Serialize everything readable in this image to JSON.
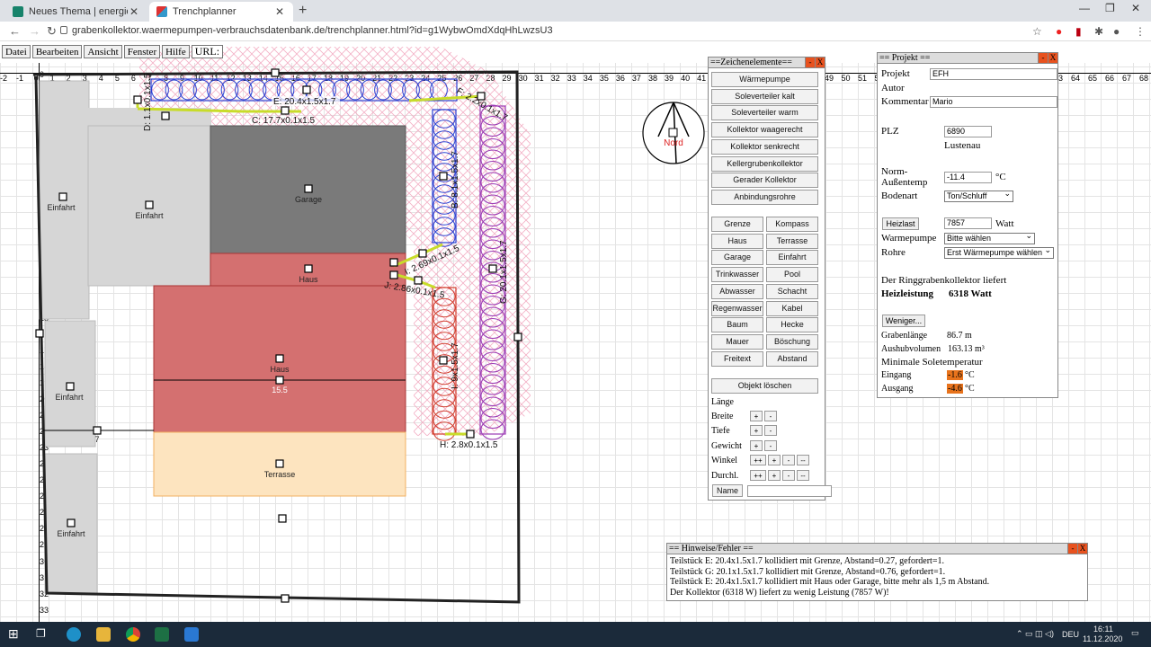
{
  "browser": {
    "tabs": [
      {
        "title": "Neues Thema | energiesparhaus.at"
      },
      {
        "title": "Trenchplanner"
      }
    ],
    "url": "grabenkollektor.waermepumpen-verbrauchsdatenbank.de/trenchplanner.html?id=g1WybwOmdXdqHhLwzsU3"
  },
  "menu": [
    "Datei",
    "Bearbeiten",
    "Ansicht",
    "Fenster",
    "Hilfe"
  ],
  "menu_url_label": "URL:",
  "scale_x": [
    "-2",
    "-1",
    "0",
    "1",
    "2",
    "3",
    "4",
    "5",
    "6",
    "7",
    "8",
    "9",
    "10",
    "11",
    "12",
    "13",
    "14",
    "15",
    "16",
    "17",
    "18",
    "19",
    "20",
    "21",
    "22",
    "23",
    "24",
    "25",
    "26",
    "27",
    "28",
    "29",
    "30",
    "31",
    "32",
    "33",
    "34",
    "35",
    "36",
    "37",
    "38",
    "39",
    "40",
    "41",
    "42"
  ],
  "scale_x_right": [
    "49",
    "50",
    "51",
    "52",
    "53"
  ],
  "scale_x_far": [
    "63",
    "64",
    "65",
    "66",
    "67",
    "68"
  ],
  "scale_y": [
    "0",
    "1",
    "2",
    "3",
    "4",
    "5",
    "6",
    "7",
    "8",
    "9",
    "10",
    "11",
    "12",
    "13",
    "14",
    "15",
    "16",
    "17",
    "18",
    "19",
    "20",
    "21",
    "22",
    "23",
    "24",
    "25",
    "26",
    "27",
    "28",
    "29",
    "30",
    "31",
    "32",
    "33"
  ],
  "plan": {
    "labels": {
      "einfahrt": "Einfahrt",
      "garage": "Garage",
      "haus": "Haus",
      "terrasse": "Terrasse",
      "nord": "Nord",
      "haus_dim": "15.5",
      "left_dim": "7"
    },
    "trench_labels": {
      "e": "E: 20.4x1.5x1.7",
      "c": "C: 17.7x0.1x1.5",
      "d": "D: 1.1x0.1x1.5",
      "f": "F: 2.2x0.1x1.7",
      "b": "B: 8.1x1.5x1.7",
      "g": "G: 20.1x1.5x1.7",
      "i": "I: 2.69x0.1x1.5",
      "j": "J: 2.86x0.1x1.5",
      "k": "I: 9x1.5x1.7",
      "h": "H: 2.8x0.1x1.5"
    }
  },
  "zeichen": {
    "title": "==Zeichenelemente==",
    "buttons_wide": [
      "Wärmepumpe",
      "Soleverteiler kalt",
      "Soleverteiler warm",
      "Kollektor waagerecht",
      "Kollektor senkrecht",
      "Kellergrubenkollektor",
      "Gerader Kollektor",
      "Anbindungsrohre"
    ],
    "buttons_grid": [
      [
        "Grenze",
        "Kompass"
      ],
      [
        "Haus",
        "Terrasse"
      ],
      [
        "Garage",
        "Einfahrt"
      ],
      [
        "Trinkwasser",
        "Pool"
      ],
      [
        "Abwasser",
        "Schacht"
      ],
      [
        "Regenwasser",
        "Kabel"
      ],
      [
        "Baum",
        "Hecke"
      ],
      [
        "Mauer",
        "Böschung"
      ],
      [
        "Freitext",
        "Abstand"
      ]
    ],
    "delete": "Objekt löschen",
    "props": [
      "Länge",
      "Breite",
      "Tiefe",
      "Gewicht",
      "Winkel",
      "Durchl."
    ],
    "name_btn": "Name"
  },
  "projekt": {
    "title": "== Projekt ==",
    "projekt_label": "Projekt",
    "projekt_value": "EFH",
    "autor_label": "Autor",
    "kommentar_label": "Kommentar",
    "kommentar_value": "Mario",
    "plz_label": "PLZ",
    "plz_value": "6890",
    "ort": "Lustenau",
    "norm_label1": "Norm-",
    "norm_label2": "Außentemp",
    "norm_value": "-11.4",
    "norm_unit": "°C",
    "boden_label": "Bodenart",
    "boden_value": "Ton/Schluff",
    "heizlast_btn": "Heizlast",
    "heizlast_value": "7857",
    "heizlast_unit": "Watt",
    "wp_label": "Warmepumpe",
    "wp_value": "Bitte wählen",
    "rohre_label": "Rohre",
    "rohre_value": "Erst Wärmepumpe wählen",
    "liefert": "Der Ringgrabenkollektor liefert",
    "heizleistung_label": "Heizleistung",
    "heizleistung_value": "6318 Watt",
    "weniger_btn": "Weniger...",
    "graben_label": "Grabenlänge",
    "graben_value": "86.7 m",
    "aushub_label": "Aushubvolumen",
    "aushub_value": "163.13 m³",
    "minsole": "Minimale Soletemperatur",
    "eingang_label": "Eingang",
    "eingang_value": "-1.6",
    "eingang_unit": "°C",
    "ausgang_label": "Ausgang",
    "ausgang_value": "-4.6",
    "ausgang_unit": "°C"
  },
  "hinweise": {
    "title": "== Hinweise/Fehler ==",
    "lines": [
      "Teilstück E: 20.4x1.5x1.7 kollidiert mit Grenze, Abstand=0.27, gefordert=1.",
      "Teilstück G: 20.1x1.5x1.7 kollidiert mit Grenze, Abstand=0.76, gefordert=1.",
      "Teilstück E: 20.4x1.5x1.7 kollidiert mit Haus oder Garage, bitte mehr als 1,5 m Abstand.",
      "Der Kollektor (6318 W) liefert zu wenig Leistung (7857 W)!"
    ]
  },
  "taskbar": {
    "lang": "DEU",
    "time": "16:11",
    "date": "11.12.2020"
  },
  "colors": {
    "haus": "#d47070",
    "garage": "#7a7a7a",
    "terrasse": "#fde4bf",
    "einfahrt": "#d6d6d6",
    "blue_coil": "#2a3fd1",
    "purple_coil": "#9b3ab4",
    "red_coil": "#d13a2a",
    "pipe": "#c8dc2a"
  }
}
